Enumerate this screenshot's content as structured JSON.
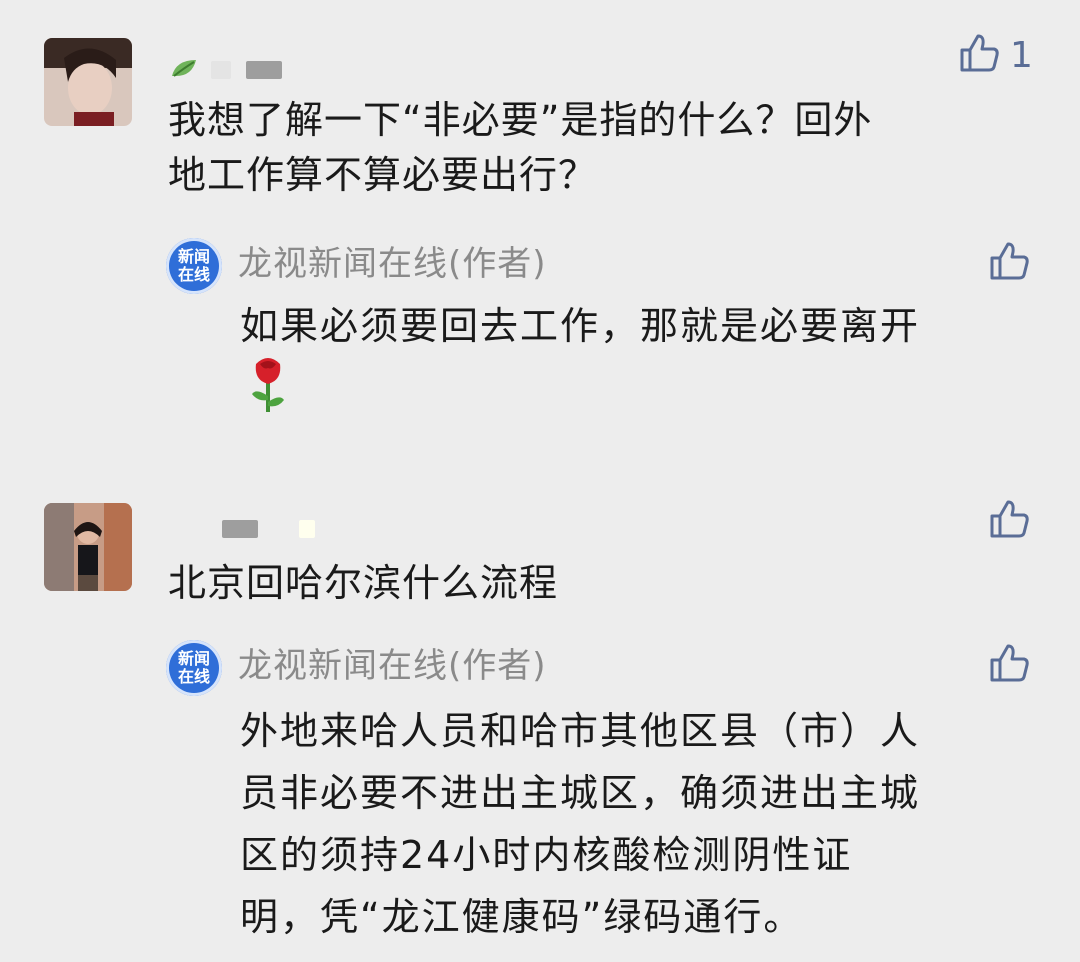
{
  "colors": {
    "background": "#ededed",
    "like_icon": "#5a6d96",
    "author_name": "#8a8a8a",
    "badge_blue": "#2f6ed8"
  },
  "comments": [
    {
      "like_count": "1",
      "text": "我想了解一下“非必要”是指的什么？回外\n地工作算不算必要出行？",
      "reply": {
        "author_badge": [
          "新闻",
          "在线"
        ],
        "author_name": "龙视新闻在线(作者)",
        "text": "如果必须要回去工作，那就是必要离开",
        "emoji": "rose-emoji"
      }
    },
    {
      "text": "北京回哈尔滨什么流程",
      "reply": {
        "author_badge": [
          "新闻",
          "在线"
        ],
        "author_name": "龙视新闻在线(作者)",
        "text": "外地来哈人员和哈市其他区县（市）人\n员非必要不进出主城区，确须进出主城\n区的须持24小时内核酸检测阴性证\n明，凭“龙江健康码”绿码通行。"
      }
    }
  ]
}
